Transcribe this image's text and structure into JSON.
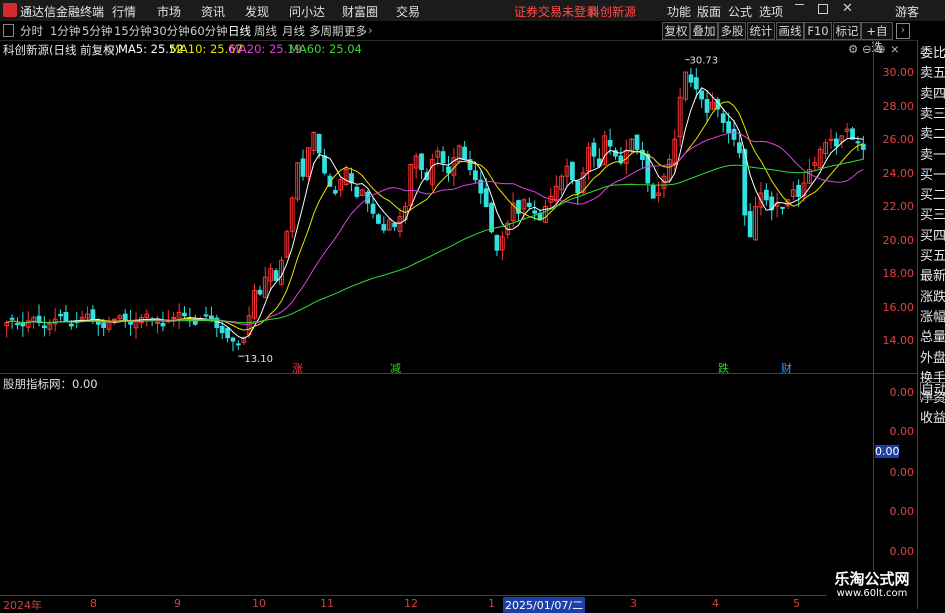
{
  "menu": {
    "app_title": "通达信金融终端",
    "items": [
      "行情",
      "市场",
      "资讯",
      "发现",
      "问小达",
      "财富圈",
      "交易"
    ],
    "status_notice": "证券交易未登录",
    "stock_name": "科创新源",
    "right_items": [
      "功能",
      "版面",
      "公式",
      "选项"
    ],
    "guest_label": "游客"
  },
  "periods": [
    "分时",
    "1分钟",
    "5分钟",
    "15分钟",
    "30分钟",
    "60分钟",
    "日线",
    "周线",
    "月线",
    "多周期",
    "更多"
  ],
  "active_period": "日线",
  "toolbar_right": [
    "复权",
    "叠加",
    "多股",
    "统计",
    "画线",
    "F10",
    "标记",
    "+自选"
  ],
  "chart_header": {
    "title": "科创新源(日线 前复权)",
    "ma_labels": [
      {
        "label": "MA5: 25.52",
        "color": "#ffffff"
      },
      {
        "label": "MA10: 25.67",
        "color": "#e6e600"
      },
      {
        "label": "MA20: 25.19",
        "color": "#e040e0"
      },
      {
        "label": "MA60: 25.04",
        "color": "#33dd33"
      }
    ]
  },
  "price_axis": [
    "30.00",
    "28.00",
    "26.00",
    "24.00",
    "22.00",
    "20.00",
    "18.00",
    "16.00",
    "14.00"
  ],
  "markers": {
    "high": "30.73",
    "low": "13.10"
  },
  "event_markers": [
    {
      "text": "涨",
      "color": "#ff3333"
    },
    {
      "text": "减",
      "color": "#33cc33"
    },
    {
      "text": "跌",
      "color": "#33cc33"
    },
    {
      "text": "财",
      "color": "#3399ff"
    }
  ],
  "indicator": {
    "title": "股朋指标网：0.00",
    "axis": [
      "0.00",
      "0.00",
      "0.00",
      "0.00",
      "0.00",
      "0.00"
    ],
    "current": "0.00"
  },
  "side_panel": [
    "委比",
    "卖五",
    "卖四",
    "卖三",
    "卖二",
    "卖一",
    "买一",
    "买二",
    "买三",
    "买四",
    "买五",
    "最新",
    "涨跌",
    "涨幅",
    "总量",
    "外盘",
    "换手",
    "净资",
    "收益",
    "自动"
  ],
  "date_axis": [
    "2024年",
    "8",
    "9",
    "10",
    "11",
    "12",
    "1",
    "2025/01/07/二",
    "3",
    "4",
    "5"
  ],
  "watermark": {
    "name": "乐淘公式网",
    "url": "www.60lt.com"
  },
  "colors": {
    "up": "#ff3333",
    "down": "#33e0e0",
    "ma5": "#ffffff",
    "ma10": "#e6e600",
    "ma20": "#e040e0",
    "ma60": "#33dd33",
    "axis": "#9b1c1c"
  },
  "chart_data": {
    "type": "candlestick",
    "y_range": [
      13.0,
      31.0
    ],
    "closes": [
      15.1,
      15.3,
      15.0,
      14.9,
      15.2,
      15.4,
      15.1,
      14.8,
      15.0,
      15.3,
      15.5,
      15.2,
      14.9,
      15.1,
      15.4,
      15.6,
      15.3,
      15.0,
      14.8,
      15.1,
      15.3,
      15.5,
      15.2,
      15.0,
      15.2,
      15.4,
      15.6,
      15.3,
      15.1,
      14.9,
      15.2,
      15.4,
      15.7,
      15.5,
      15.2,
      15.0,
      15.3,
      15.5,
      15.2,
      14.8,
      14.5,
      14.2,
      14.0,
      13.8,
      14.2,
      15.5,
      17.0,
      16.8,
      17.8,
      18.3,
      17.6,
      18.8,
      20.5,
      22.5,
      24.6,
      23.8,
      25.5,
      26.4,
      25.2,
      24.0,
      23.2,
      22.8,
      23.6,
      24.2,
      23.4,
      22.6,
      23.0,
      22.2,
      21.6,
      21.0,
      20.6,
      21.2,
      20.8,
      21.4,
      22.0,
      24.5,
      25.0,
      24.2,
      23.6,
      24.8,
      25.3,
      24.6,
      24.0,
      24.9,
      25.6,
      24.8,
      24.2,
      23.6,
      22.8,
      22.0,
      20.5,
      19.4,
      20.2,
      21.0,
      22.2,
      21.6,
      22.4,
      22.0,
      21.6,
      21.2,
      22.0,
      22.6,
      23.2,
      23.8,
      24.4,
      23.6,
      22.8,
      24.0,
      25.5,
      25.0,
      24.4,
      26.2,
      25.6,
      25.0,
      24.6,
      25.3,
      26.0,
      25.4,
      24.8,
      23.4,
      22.5,
      22.8,
      23.8,
      24.8,
      26.0,
      28.5,
      30.0,
      29.4,
      29.0,
      28.4,
      27.6,
      28.2,
      27.8,
      27.0,
      26.4,
      26.0,
      25.2,
      21.5,
      20.2,
      22.0,
      22.8,
      22.4,
      21.8,
      22.2,
      21.9,
      22.4,
      23.0,
      22.6,
      23.4,
      24.2,
      24.6,
      25.4,
      25.8,
      26.0,
      25.6,
      26.2,
      26.6,
      26.0,
      25.8,
      25.4
    ]
  }
}
